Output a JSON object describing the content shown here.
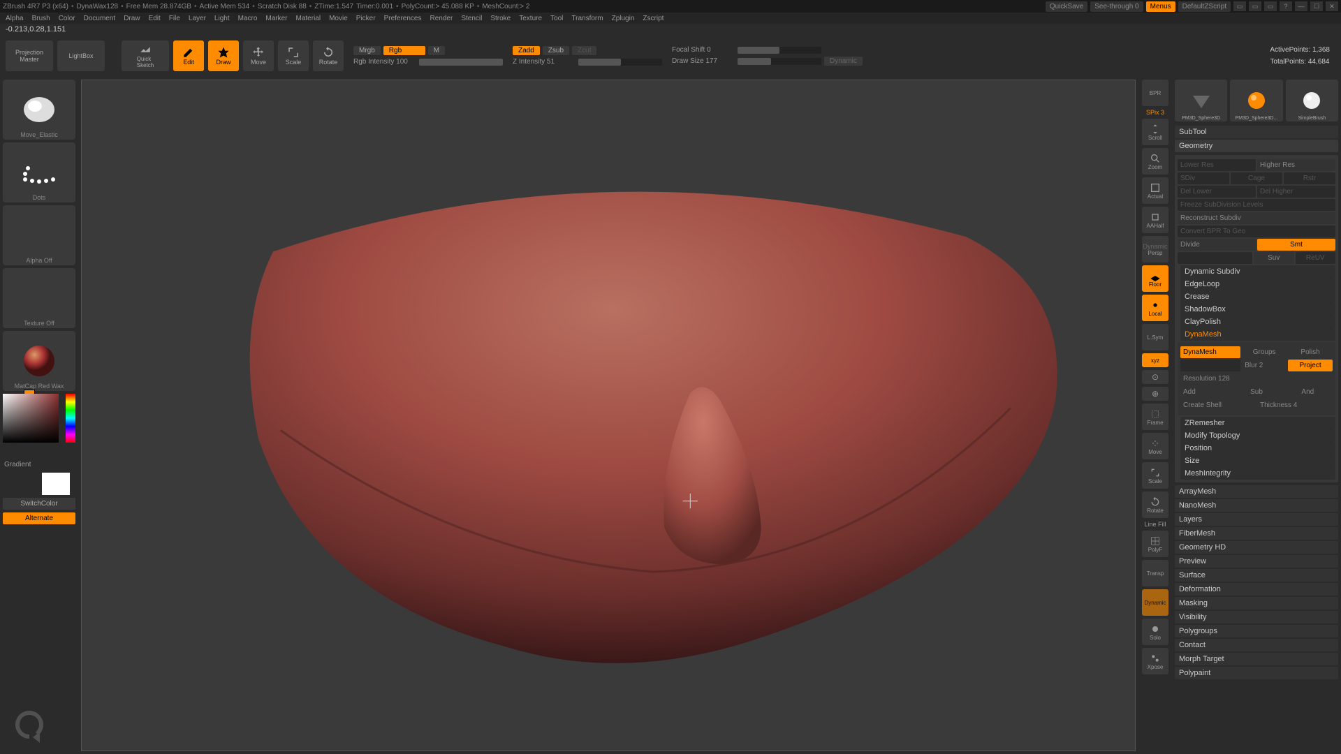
{
  "title": {
    "app": "ZBrush 4R7 P3 (x64)",
    "mat": "DynaWax128",
    "freemem": "Free Mem 28.874GB",
    "activemem": "Active Mem 534",
    "scratch": "Scratch Disk 88",
    "ztime": "ZTime:1.547",
    "timer": "Timer:0.001",
    "polycount": "PolyCount:> 45.088 KP",
    "meshcount": "MeshCount:> 2",
    "quicksave": "QuickSave",
    "seethrough": "See-through  0",
    "menus": "Menus",
    "layout": "DefaultZScript"
  },
  "menu": [
    "Alpha",
    "Brush",
    "Color",
    "Document",
    "Draw",
    "Edit",
    "File",
    "Layer",
    "Light",
    "Macro",
    "Marker",
    "Material",
    "Movie",
    "Picker",
    "Preferences",
    "Render",
    "Stencil",
    "Stroke",
    "Texture",
    "Tool",
    "Transform",
    "Zplugin",
    "Zscript"
  ],
  "coords": "-0.213,0.28,1.151",
  "toolbar": {
    "projection": "Projection\nMaster",
    "lightbox": "LightBox",
    "quicksketch": "Quick\nSketch",
    "edit": "Edit",
    "draw": "Draw",
    "move": "Move",
    "scale": "Scale",
    "rotate": "Rotate",
    "mrgb": "Mrgb",
    "rgb": "Rgb",
    "m": "M",
    "rgbintensity": "Rgb Intensity 100",
    "zadd": "Zadd",
    "zsub": "Zsub",
    "zcut": "Zcut",
    "zintensity": "Z Intensity 51",
    "focalshift": "Focal Shift 0",
    "drawsize": "Draw Size 177",
    "dynamic": "Dynamic",
    "activepoints": "ActivePoints: 1,368",
    "totalpoints": "TotalPoints: 44,684"
  },
  "left": {
    "brush": "Move_Elastic",
    "stroke": "Dots",
    "alpha": "Alpha Off",
    "texture": "Texture Off",
    "material": "MatCap Red Wax",
    "gradient": "Gradient",
    "switchcolor": "SwitchColor",
    "alternate": "Alternate"
  },
  "righticons": {
    "bpr": "BPR",
    "spix": "SPix 3",
    "scroll": "Scroll",
    "zoom": "Zoom",
    "actual": "Actual",
    "aahalf": "AAHalf",
    "persp": "Persp",
    "floor": "Floor",
    "local": "Local",
    "lsym": "L.Sym",
    "xyz": "xyz",
    "frame": "Frame",
    "move": "Move",
    "scale": "Scale",
    "rotate": "Rotate",
    "linefill": "Line Fill",
    "polyf": "PolyF",
    "transp": "Transp",
    "dynamic": "Dynamic",
    "solo": "Solo",
    "xpose": "Xpose"
  },
  "rp": {
    "thumb1": "PM3D_Sphere3D",
    "thumb2": "PM3D_Sphere3D...",
    "brush": "SimpleBrush",
    "subtool": "SubTool",
    "geometry": "Geometry",
    "lowerres": "Lower Res",
    "higherres": "Higher Res",
    "sdiv": "SDiv",
    "cage": "Cage",
    "rstr": "Rstr",
    "dellower": "Del Lower",
    "delhigher": "Del Higher",
    "freeze": "Freeze SubDivision Levels",
    "reconstruct": "Reconstruct Subdiv",
    "convertbpr": "Convert BPR To Geo",
    "divide": "Divide",
    "smt": "Smt",
    "suv": "Suv",
    "rsuv": "ReUV",
    "dynsubdiv": "Dynamic Subdiv",
    "edgeloop": "EdgeLoop",
    "crease": "Crease",
    "shadowbox": "ShadowBox",
    "claypolish": "ClayPolish",
    "dynamesh": "DynaMesh",
    "dynameshbtn": "DynaMesh",
    "groups": "Groups",
    "polish": "Polish",
    "blur": "Blur 2",
    "project": "Project",
    "resolution": "Resolution 128",
    "add": "Add",
    "sub": "Sub",
    "and": "And",
    "createshell": "Create Shell",
    "thickness": "Thickness 4",
    "zremesher": "ZRemesher",
    "modifytopo": "Modify Topology",
    "position": "Position",
    "size": "Size",
    "meshintegrity": "MeshIntegrity",
    "arraymesh": "ArrayMesh",
    "nanomesh": "NanoMesh",
    "layers": "Layers",
    "fibermesh": "FiberMesh",
    "geometryhd": "Geometry HD",
    "preview": "Preview",
    "surface": "Surface",
    "deformation": "Deformation",
    "masking": "Masking",
    "visibility": "Visibility",
    "polygroups": "Polygroups",
    "contact": "Contact",
    "morphtarget": "Morph Target",
    "polypaint": "Polypaint"
  }
}
